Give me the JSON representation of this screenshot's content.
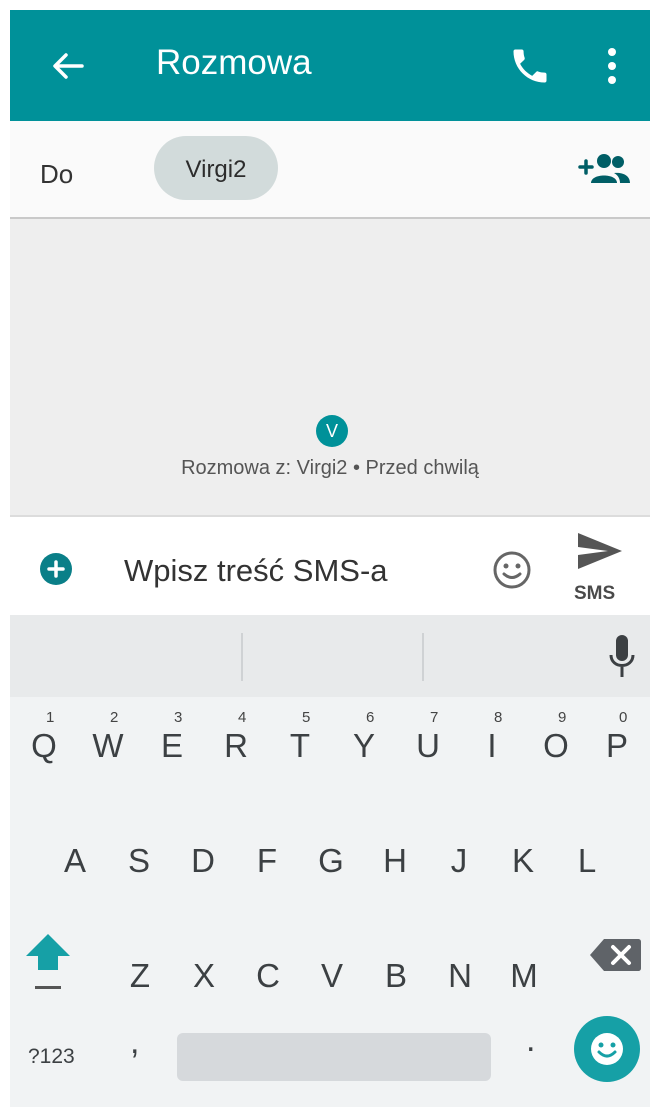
{
  "appbar": {
    "title": "Rozmowa"
  },
  "recipients": {
    "to_label": "Do",
    "chip": "Virgi2"
  },
  "conversation": {
    "avatar_letter": "V",
    "meta": "Rozmowa z: Virgi2 • Przed chwilą"
  },
  "composer": {
    "placeholder": "Wpisz treść SMS-a",
    "send_label": "SMS"
  },
  "keyboard": {
    "row1": [
      {
        "key": "Q",
        "hint": "1"
      },
      {
        "key": "W",
        "hint": "2"
      },
      {
        "key": "E",
        "hint": "3"
      },
      {
        "key": "R",
        "hint": "4"
      },
      {
        "key": "T",
        "hint": "5"
      },
      {
        "key": "Y",
        "hint": "6"
      },
      {
        "key": "U",
        "hint": "7"
      },
      {
        "key": "I",
        "hint": "8"
      },
      {
        "key": "O",
        "hint": "9"
      },
      {
        "key": "P",
        "hint": "0"
      }
    ],
    "row2": [
      "A",
      "S",
      "D",
      "F",
      "G",
      "H",
      "J",
      "K",
      "L"
    ],
    "row3": [
      "Z",
      "X",
      "C",
      "V",
      "B",
      "N",
      "M"
    ],
    "symbols_label": "?123",
    "comma": ",",
    "period": "."
  },
  "colors": {
    "accent": "#009199",
    "emoji_key": "#16a0a6"
  },
  "icons": [
    "back-arrow-icon",
    "phone-icon",
    "more-vert-icon",
    "add-person-icon",
    "add-circle-icon",
    "emoji-icon",
    "send-icon",
    "mic-icon",
    "shift-icon",
    "backspace-icon"
  ]
}
